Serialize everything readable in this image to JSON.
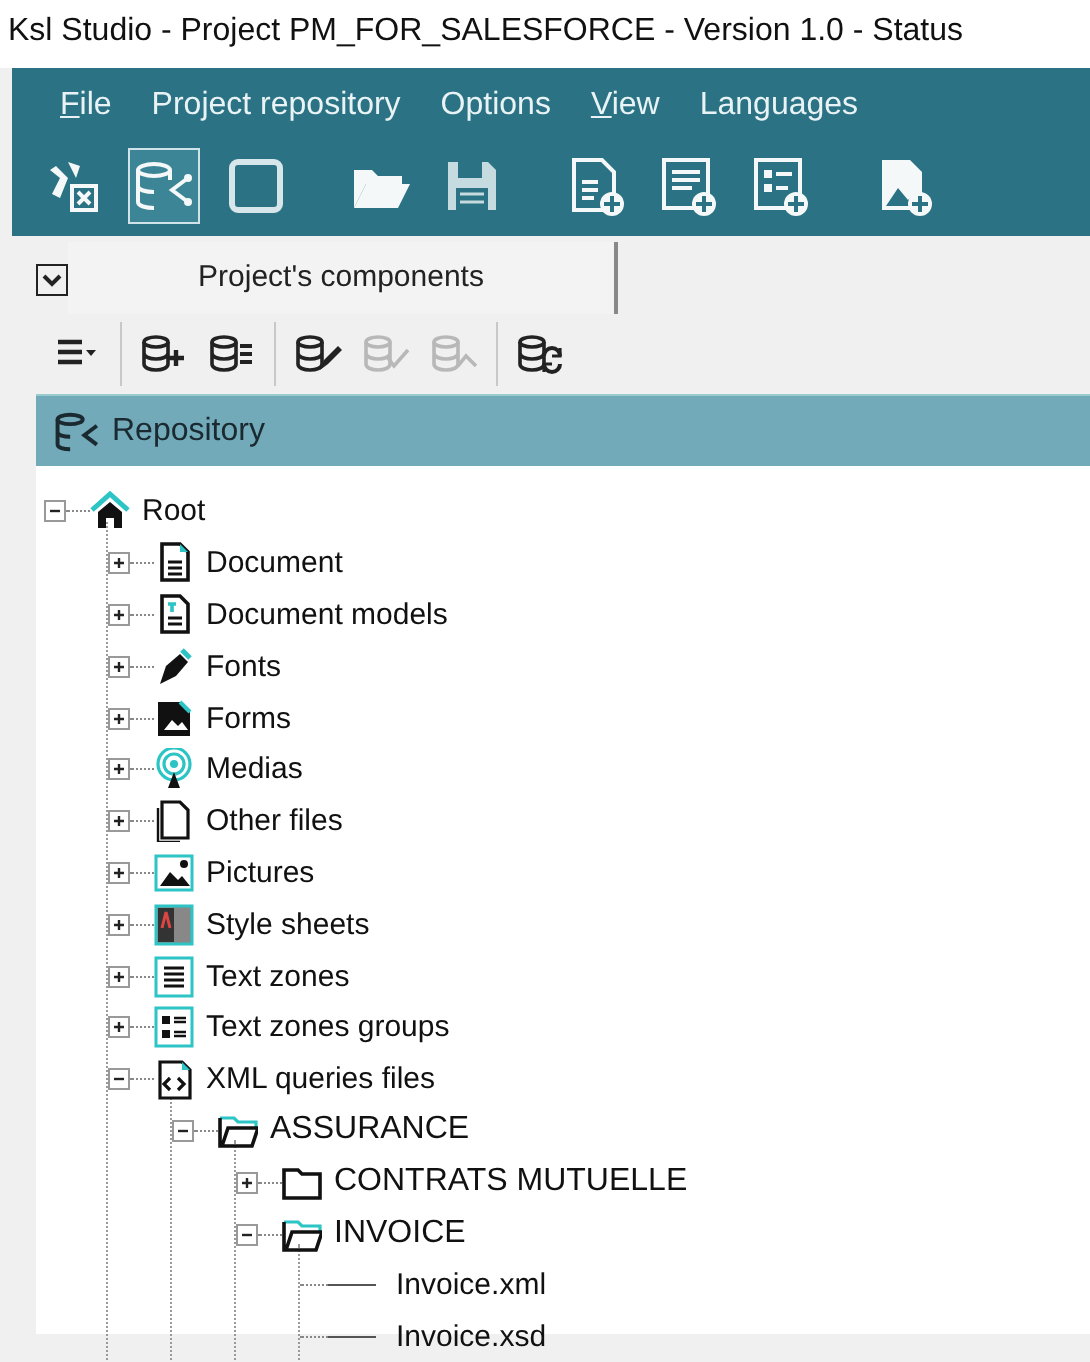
{
  "window": {
    "title": "Ksl Studio - Project PM_FOR_SALESFORCE - Version 1.0 - Status"
  },
  "menu": [
    {
      "label": "File",
      "mnemonic": true
    },
    {
      "label": "Project repository",
      "mnemonic": false
    },
    {
      "label": "Options",
      "mnemonic": false
    },
    {
      "label": "View",
      "mnemonic": true
    },
    {
      "label": "Languages",
      "mnemonic": false
    }
  ],
  "main_toolbar": [
    [
      {
        "kind": "tools",
        "pressed": false
      },
      {
        "kind": "repository",
        "pressed": true
      },
      {
        "kind": "frame",
        "pressed": false
      }
    ],
    [
      {
        "kind": "open",
        "pressed": false
      },
      {
        "kind": "save",
        "pressed": false
      }
    ],
    [
      {
        "kind": "new-doc",
        "pressed": false
      },
      {
        "kind": "new-text",
        "pressed": false
      },
      {
        "kind": "new-list",
        "pressed": false
      }
    ],
    [
      {
        "kind": "new-image",
        "pressed": false
      }
    ]
  ],
  "panel_tabs": [
    {
      "label": "Project's components",
      "selected": true
    }
  ],
  "panel_toolbar": [
    [
      {
        "kind": "menu",
        "disabled": false
      }
    ],
    [
      {
        "kind": "db-add",
        "disabled": false
      },
      {
        "kind": "db-list",
        "disabled": false
      }
    ],
    [
      {
        "kind": "db-edit",
        "disabled": false
      },
      {
        "kind": "db-check",
        "disabled": true
      },
      {
        "kind": "db-search",
        "disabled": true
      }
    ],
    [
      {
        "kind": "db-refresh",
        "disabled": false
      }
    ]
  ],
  "repository": {
    "title": "Repository",
    "tree": [
      {
        "label": "Root",
        "kind": "root",
        "expanded": true,
        "children": [
          {
            "label": "Document",
            "kind": "document",
            "expanded": false
          },
          {
            "label": "Document models",
            "kind": "model",
            "expanded": false
          },
          {
            "label": "Fonts",
            "kind": "font",
            "expanded": false
          },
          {
            "label": "Forms",
            "kind": "form",
            "expanded": false
          },
          {
            "label": "Medias",
            "kind": "media",
            "expanded": false
          },
          {
            "label": "Other files",
            "kind": "other",
            "expanded": false
          },
          {
            "label": "Pictures",
            "kind": "picture",
            "expanded": false
          },
          {
            "label": "Style sheets",
            "kind": "style",
            "expanded": false
          },
          {
            "label": "Text zones",
            "kind": "textzone",
            "expanded": false
          },
          {
            "label": "Text zones groups",
            "kind": "textgroup",
            "expanded": false
          },
          {
            "label": "XML queries files",
            "kind": "xml",
            "expanded": true,
            "children": [
              {
                "label": "ASSURANCE",
                "kind": "folder",
                "expanded": true,
                "children": [
                  {
                    "label": "CONTRATS MUTUELLE",
                    "kind": "folder",
                    "expanded": false
                  },
                  {
                    "label": "INVOICE",
                    "kind": "folder",
                    "expanded": true,
                    "children": [
                      {
                        "label": "Invoice.xml"
                      },
                      {
                        "label": "Invoice.xsd"
                      }
                    ]
                  }
                ]
              }
            ]
          }
        ]
      }
    ]
  }
}
